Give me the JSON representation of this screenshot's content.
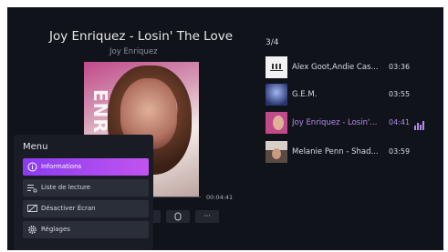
{
  "now_playing": {
    "title": "Joy Enriquez - Losin' The Love",
    "artist": "Joy Enriquez",
    "cover_text": "ENRIQUEZ",
    "total_time": "00:04:41",
    "controls": {
      "more_label": "···"
    }
  },
  "queue": {
    "position": "3/4",
    "items": [
      {
        "title": "Alex Goot,Andie Cas...",
        "duration": "03:36",
        "thumb_color": "#f2f2f2"
      },
      {
        "title": "G.E.M.",
        "duration": "03:55",
        "thumb_color": "#4a5aa0"
      },
      {
        "title": "Joy Enriquez - Losin'...",
        "duration": "04:41",
        "thumb_color": "#c04a8a",
        "active": true
      },
      {
        "title": "Melanie Penn - Shad...",
        "duration": "03:59",
        "thumb_color": "#5a4a44"
      }
    ]
  },
  "menu": {
    "title": "Menu",
    "items": [
      {
        "label": "Informations",
        "icon": "info-icon",
        "selected": true
      },
      {
        "label": "Liste de lecture",
        "icon": "playlist-icon"
      },
      {
        "label": "Désactiver Écran",
        "icon": "screen-off-icon"
      },
      {
        "label": "Réglages",
        "icon": "settings-icon"
      }
    ]
  },
  "colors": {
    "accent": "#b58af0",
    "selected_gradient_start": "#8a3cf0",
    "selected_gradient_end": "#c254f0",
    "background": "#101319"
  }
}
